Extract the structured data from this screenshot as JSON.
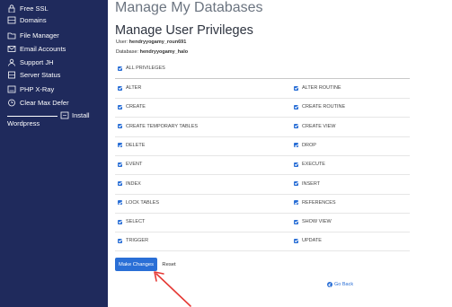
{
  "sidebar": {
    "items": [
      {
        "label": "Free SSL",
        "icon": "lock-icon"
      },
      {
        "label": "Domains",
        "icon": "globe-icon"
      },
      {
        "label": "File Manager",
        "icon": "folder-icon"
      },
      {
        "label": "Email Accounts",
        "icon": "envelope-icon"
      },
      {
        "label": "Support JH",
        "icon": "person-icon"
      },
      {
        "label": "Server Status",
        "icon": "server-icon"
      },
      {
        "label": "PHP X-Ray",
        "icon": "scan-icon"
      },
      {
        "label": "Clear Max Defer",
        "icon": "clock-icon"
      }
    ],
    "install_label": "Install",
    "wordpress_label": "Wordpress"
  },
  "page": {
    "title": "Manage My Databases",
    "section_title": "Manage User Privileges",
    "user_label": "User:",
    "user_value": "hendryyogamy_roun691",
    "database_label": "Database:",
    "database_value": "hendryyogamy_halo"
  },
  "privileges": {
    "all_label": "ALL PRIVILEGES",
    "rows": [
      [
        "ALTER",
        "ALTER ROUTINE"
      ],
      [
        "CREATE",
        "CREATE ROUTINE"
      ],
      [
        "CREATE TEMPORARY TABLES",
        "CREATE VIEW"
      ],
      [
        "DELETE",
        "DROP"
      ],
      [
        "EVENT",
        "EXECUTE"
      ],
      [
        "INDEX",
        "INSERT"
      ],
      [
        "LOCK TABLES",
        "REFERENCES"
      ],
      [
        "SELECT",
        "SHOW VIEW"
      ],
      [
        "TRIGGER",
        "UPDATE"
      ]
    ]
  },
  "actions": {
    "make_changes": "Make Changes",
    "reset": "Reset",
    "go_back": "Go Back"
  },
  "colors": {
    "sidebar_bg": "#1f2a5c",
    "accent": "#2a6fd6",
    "annotation_arrow": "#e53935"
  }
}
